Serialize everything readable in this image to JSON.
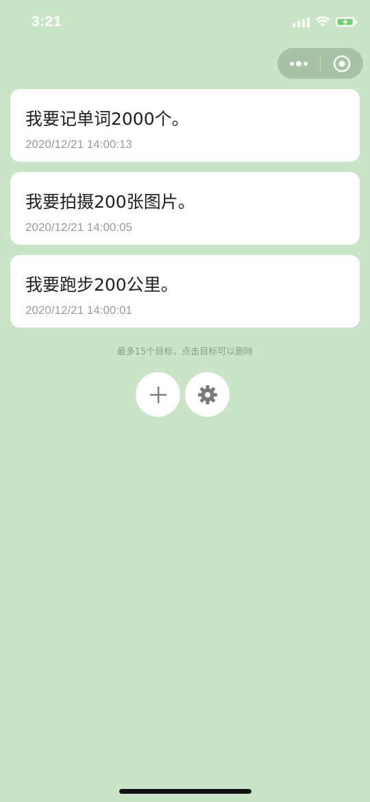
{
  "status_bar": {
    "time": "3:21",
    "signal_icon": "signal-icon",
    "wifi_icon": "wifi-icon",
    "battery_icon": "battery-charging-icon",
    "battery_level": 0.8
  },
  "capsule": {
    "more_icon": "more-icon",
    "close_icon": "circle-dot-icon"
  },
  "goals": [
    {
      "title": "我要记单词2000个。",
      "time": "2020/12/21 14:00:13"
    },
    {
      "title": "我要拍摄200张图片。",
      "time": "2020/12/21 14:00:05"
    },
    {
      "title": "我要跑步200公里。",
      "time": "2020/12/21 14:00:01"
    }
  ],
  "hint": "最多15个目标，点击目标可以删除",
  "actions": {
    "add_icon": "plus-icon",
    "settings_icon": "gear-icon"
  },
  "colors": {
    "background": "#cae4c8",
    "card": "#ffffff",
    "capsule": "#a7c3a5",
    "battery": "#6ad36b"
  }
}
